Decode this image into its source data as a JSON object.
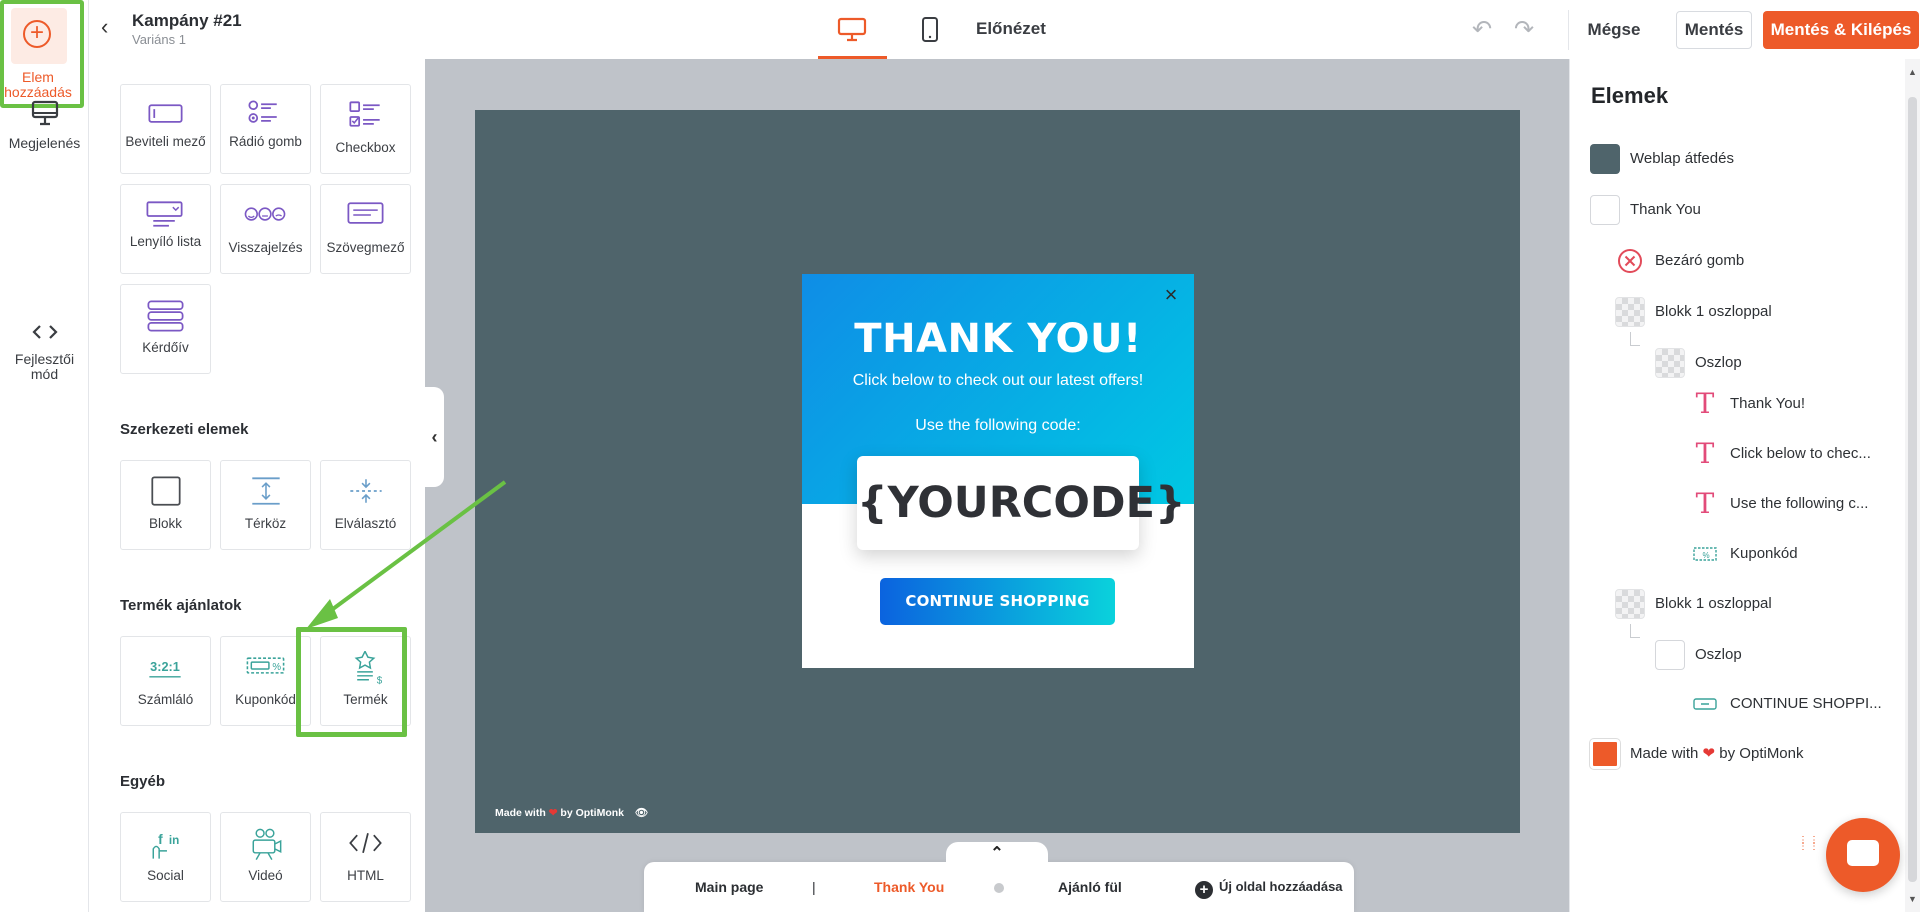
{
  "header": {
    "campaign": "Kampány #21",
    "variant": "Variáns 1",
    "preview": "Előnézet",
    "cancel": "Mégse",
    "save": "Mentés",
    "save_exit": "Mentés & Kilépés"
  },
  "rail": {
    "appearance": "Megjelenés",
    "add_element": "Elem hozzáadás",
    "dev_mode": "Fejlesztői mód"
  },
  "panel": {
    "inputs": [
      {
        "label": "Beviteli mező",
        "icon": "input-field-icon"
      },
      {
        "label": "Rádió gomb",
        "icon": "radio-button-icon"
      },
      {
        "label": "Checkbox",
        "icon": "checkbox-icon"
      },
      {
        "label": "Lenyíló lista",
        "icon": "dropdown-icon"
      },
      {
        "label": "Visszajelzés",
        "icon": "feedback-icon"
      },
      {
        "label": "Szövegmező",
        "icon": "textarea-icon"
      },
      {
        "label": "Kérdőív",
        "icon": "survey-icon"
      }
    ],
    "structure_title": "Szerkezeti elemek",
    "structure": [
      {
        "label": "Blokk",
        "icon": "block-icon"
      },
      {
        "label": "Térköz",
        "icon": "spacer-icon"
      },
      {
        "label": "Elválasztó",
        "icon": "divider-icon"
      }
    ],
    "product_title": "Termék ajánlatok",
    "product": [
      {
        "label": "Számláló",
        "icon": "counter-icon"
      },
      {
        "label": "Kuponkód",
        "icon": "coupon-icon"
      },
      {
        "label": "Termék",
        "icon": "product-icon"
      }
    ],
    "other_title": "Egyéb",
    "other": [
      {
        "label": "Social",
        "icon": "social-icon"
      },
      {
        "label": "Videó",
        "icon": "video-icon"
      },
      {
        "label": "HTML",
        "icon": "html-icon"
      }
    ]
  },
  "popup": {
    "title": "THANK YOU!",
    "subtitle": "Click below to check out our latest offers!",
    "use_code": "Use the following code:",
    "code": "{YOURCODE}",
    "button": "CONTINUE SHOPPING"
  },
  "stage": {
    "made_with": "Made with",
    "by": "by OptiMonk"
  },
  "pages": {
    "main": "Main page",
    "separator": "|",
    "thank_you": "Thank You",
    "offer_tab": "Ajánló fül",
    "add_page": "Új oldal hozzáadása"
  },
  "elements": {
    "title": "Elemek",
    "items": [
      {
        "label": "Weblap átfedés"
      },
      {
        "label": "Thank You"
      },
      {
        "label": "Bezáró gomb"
      },
      {
        "label": "Blokk 1 oszloppal"
      },
      {
        "label": "Oszlop"
      },
      {
        "label": "Thank You!"
      },
      {
        "label": "Click below to chec..."
      },
      {
        "label": "Use the following c..."
      },
      {
        "label": "Kuponkód"
      },
      {
        "label": "Blokk 1 oszloppal"
      },
      {
        "label": "Oszlop"
      },
      {
        "label": "CONTINUE SHOPPI..."
      },
      {
        "label": "Made with"
      },
      {
        "label": "by OptiMonk"
      }
    ]
  },
  "colors": {
    "brand": "#ed5a29",
    "highlight": "#6ac144",
    "overlay": "#4f646b"
  }
}
